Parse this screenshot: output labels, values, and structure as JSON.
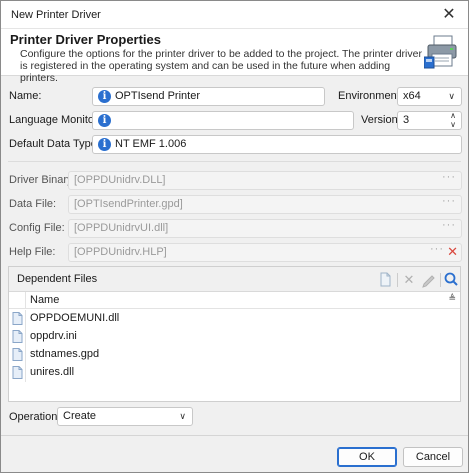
{
  "window": {
    "title": "New Printer Driver",
    "close_glyph": "✕"
  },
  "header": {
    "title": "Printer Driver Properties",
    "description": "Configure the options for the printer driver to be added to the project. The printer driver is registered in the operating system and can be used in the future when adding printers.",
    "icon": "printer-driver-icon"
  },
  "fields": {
    "name_label": "Name:",
    "name_value": "OPTIsend Printer",
    "environment_label": "Environment:",
    "environment_value": "x64",
    "language_monitor_label": "Language Monitor:",
    "language_monitor_value": "",
    "version_label": "Version:",
    "version_value": "3",
    "default_data_type_label": "Default Data Type:",
    "default_data_type_value": "NT EMF 1.006",
    "driver_binary_label": "Driver Binary:",
    "driver_binary_value": "[OPPDUnidrv.DLL]",
    "data_file_label": "Data File:",
    "data_file_value": "[OPTIsendPrinter.gpd]",
    "config_file_label": "Config File:",
    "config_file_value": "[OPPDUnidrvUI.dll]",
    "help_file_label": "Help File:",
    "help_file_value": "[OPPDUnidrv.HLP]",
    "browse_glyph": "···",
    "clear_glyph": "✕"
  },
  "dependent_files": {
    "title": "Dependent Files",
    "column_name": "Name",
    "items": [
      "OPPDOEMUNI.dll",
      "oppdrv.ini",
      "stdnames.gpd",
      "unires.dll"
    ]
  },
  "operation": {
    "label": "Operation:",
    "value": "Create"
  },
  "buttons": {
    "ok": "OK",
    "cancel": "Cancel"
  },
  "colors": {
    "accent": "#2a6fcf",
    "info": "#2a6fcf",
    "clear": "#d9473d"
  }
}
